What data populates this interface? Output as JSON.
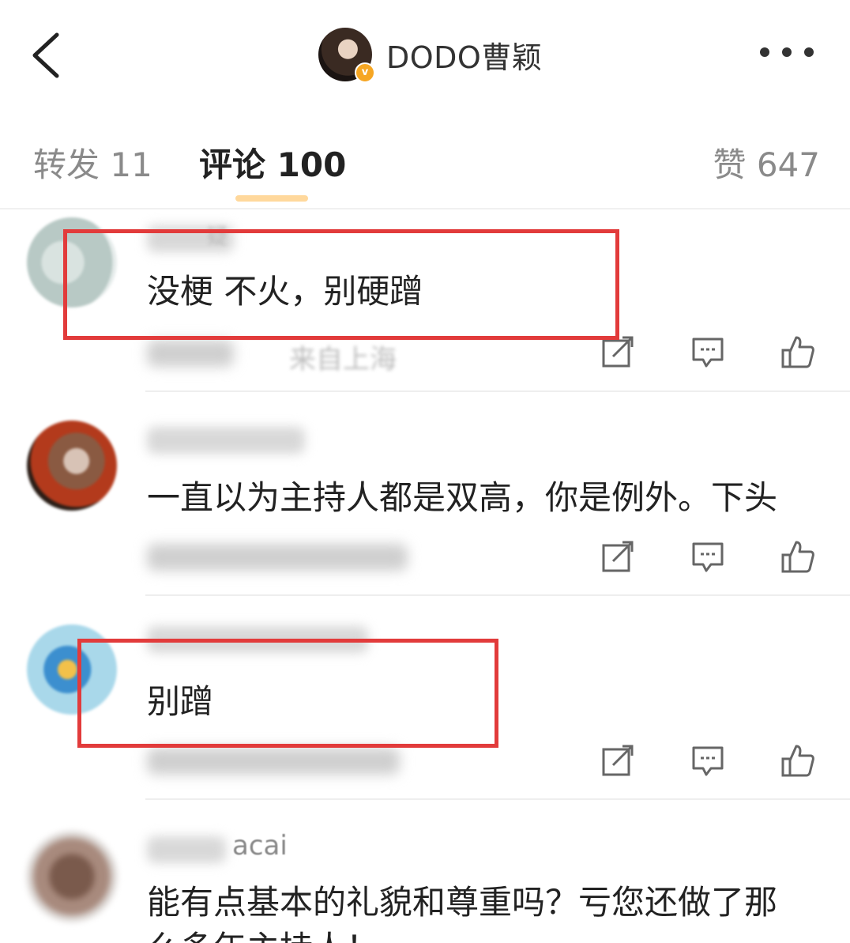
{
  "header": {
    "back_icon": "chevron-left-icon",
    "username": "DODO曹颖",
    "verified_icon": "verified-badge-icon",
    "verified_mark": "v",
    "more_icon": "more-dots-icon"
  },
  "tabs": {
    "repost": "转发 11",
    "comment": "评论 100",
    "like": "赞 647"
  },
  "comments": [
    {
      "text": "没梗 不火，别硬蹭",
      "name_fragment": "疑",
      "meta_fragment": "来自上海"
    },
    {
      "text": "一直以为主持人都是双高，你是例外。下头"
    },
    {
      "text": "别蹭"
    },
    {
      "text": "能有点基本的礼貌和尊重吗？亏您还做了那",
      "text_line2": "么多年主持人！",
      "name_fragment": "acai"
    }
  ],
  "icons": {
    "share": "share-icon",
    "reply": "comment-icon",
    "like": "thumbs-up-icon"
  },
  "colors": {
    "highlight": "#e23b3b",
    "tab_indicator": "#ffb84a",
    "verified": "#f6a623"
  }
}
